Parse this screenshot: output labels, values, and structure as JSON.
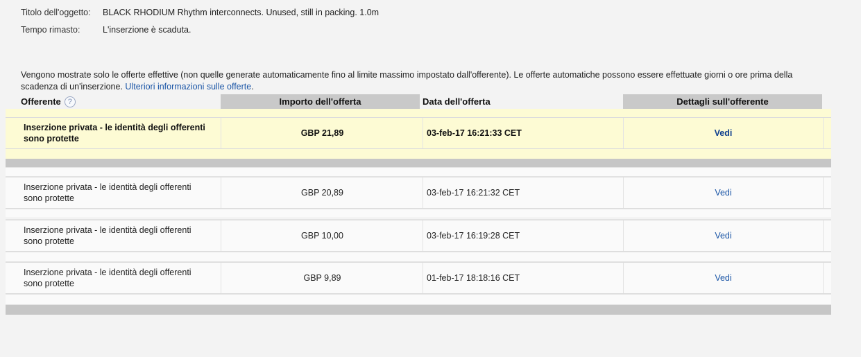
{
  "item": {
    "title_label": "Titolo dell'oggetto:",
    "title_value": "BLACK RHODIUM Rhythm interconnects. Unused, still in packing. 1.0m",
    "time_label": "Tempo rimasto:",
    "time_value": "L'inserzione è scaduta."
  },
  "intro": {
    "text": "Vengono mostrate solo le offerte effettive (non quelle generate automaticamente fino al limite massimo impostato dall'offerente). Le offerte automatiche possono essere effettuate giorni o ore prima della scadenza di un'inserzione.",
    "link": "Ulteriori informazioni sulle offerte",
    "end": "."
  },
  "table": {
    "headers": {
      "bidder": "Offerente",
      "help_icon": "?",
      "amount": "Importo dell'offerta",
      "date": "Data dell'offerta",
      "details": "Dettagli sull'offerente"
    },
    "rows": [
      {
        "bidder": "Inserzione privata - le identità degli offerenti sono protette",
        "amount": "GBP 21,89",
        "date": "03-feb-17 16:21:33 CET",
        "details": "Vedi"
      },
      {
        "bidder": "Inserzione privata - le identità degli offerenti sono protette",
        "amount": "GBP 20,89",
        "date": "03-feb-17 16:21:32 CET",
        "details": "Vedi"
      },
      {
        "bidder": "Inserzione privata - le identità degli offerenti sono protette",
        "amount": "GBP 10,00",
        "date": "03-feb-17 16:19:28 CET",
        "details": "Vedi"
      },
      {
        "bidder": "Inserzione privata - le identità degli offerenti sono protette",
        "amount": "GBP 9,89",
        "date": "01-feb-17 18:18:16 CET",
        "details": "Vedi"
      }
    ]
  },
  "colors": {
    "highlight_row": "#fdfbd4",
    "link": "#1a55a6",
    "header_shade": "#c9c9c9"
  }
}
